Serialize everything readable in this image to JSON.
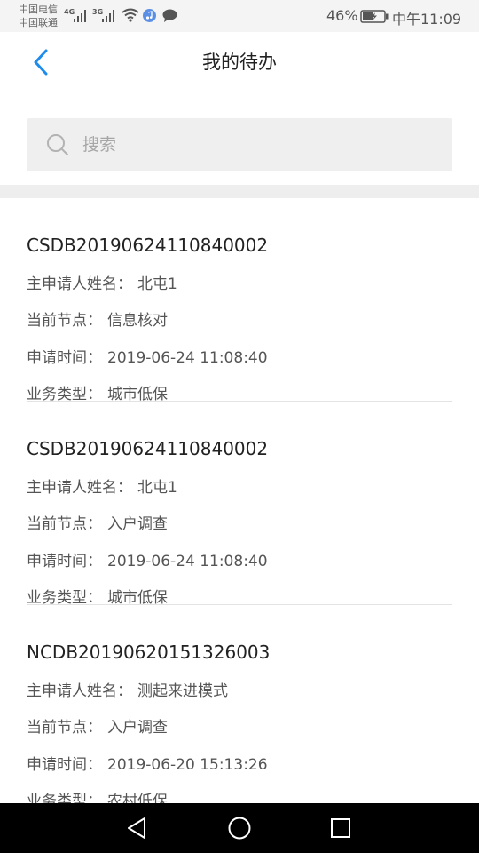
{
  "status_bar": {
    "carrier_top": "中国电信",
    "carrier_bottom": "中国联通",
    "network_1": "4G",
    "network_2": "3G",
    "battery": "46%",
    "time": "中午11:09",
    "icons": [
      "signal-icon",
      "wifi-icon",
      "music-icon",
      "chat-icon",
      "battery-icon"
    ]
  },
  "header": {
    "back_icon": "chevron-left-icon",
    "title": "我的待办"
  },
  "search": {
    "icon": "search-icon",
    "placeholder": "搜索",
    "value": ""
  },
  "labels": {
    "applicant": "主申请人姓名：",
    "node": "当前节点：",
    "time": "申请时间：",
    "type": "业务类型："
  },
  "items": [
    {
      "code": "CSDB20190624110840002",
      "applicant": "北屯1",
      "node": "信息核对",
      "time": "2019-06-24 11:08:40",
      "type": "城市低保"
    },
    {
      "code": "CSDB20190624110840002",
      "applicant": "北屯1",
      "node": "入户调查",
      "time": "2019-06-24 11:08:40",
      "type": "城市低保"
    },
    {
      "code": "NCDB20190620151326003",
      "applicant": "测起来进模式",
      "node": "入户调查",
      "time": "2019-06-20 15:13:26",
      "type": "农村低保"
    }
  ],
  "nav_bar": {
    "icons": [
      "nav-back-icon",
      "nav-home-icon",
      "nav-recent-icon"
    ]
  },
  "colors": {
    "accent": "#1f8ceb",
    "status_bar_bg": "#f4f4f4",
    "search_bg": "#efefef",
    "divider": "#eeeeee",
    "nav_bar_bg": "#000000"
  }
}
